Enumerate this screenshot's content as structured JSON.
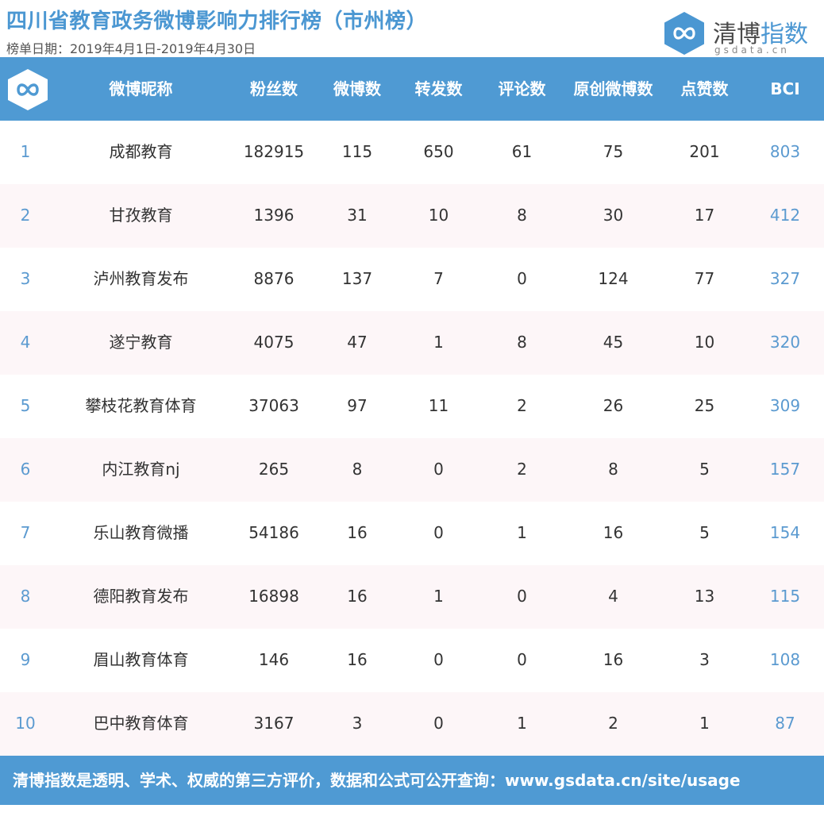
{
  "title": "四川省教育政务微博影响力排行榜（市州榜）",
  "date_range": "榜单日期：2019年4月1日-2019年4月30日",
  "brand": {
    "name_part1": "清博",
    "name_part2": "指数",
    "domain": "gsdata.cn",
    "color": "#4b97d2"
  },
  "columns": [
    "微博昵称",
    "粉丝数",
    "微博数",
    "转发数",
    "评论数",
    "原创微博数",
    "点赞数",
    "BCI"
  ],
  "rows": [
    {
      "rank": "1",
      "name": "成都教育",
      "fans": "182915",
      "posts": "115",
      "reposts": "650",
      "comments": "61",
      "original": "75",
      "likes": "201",
      "bci": "803"
    },
    {
      "rank": "2",
      "name": "甘孜教育",
      "fans": "1396",
      "posts": "31",
      "reposts": "10",
      "comments": "8",
      "original": "30",
      "likes": "17",
      "bci": "412"
    },
    {
      "rank": "3",
      "name": "泸州教育发布",
      "fans": "8876",
      "posts": "137",
      "reposts": "7",
      "comments": "0",
      "original": "124",
      "likes": "77",
      "bci": "327"
    },
    {
      "rank": "4",
      "name": "遂宁教育",
      "fans": "4075",
      "posts": "47",
      "reposts": "1",
      "comments": "8",
      "original": "45",
      "likes": "10",
      "bci": "320"
    },
    {
      "rank": "5",
      "name": "攀枝花教育体育",
      "fans": "37063",
      "posts": "97",
      "reposts": "11",
      "comments": "2",
      "original": "26",
      "likes": "25",
      "bci": "309"
    },
    {
      "rank": "6",
      "name": "内江教育nj",
      "fans": "265",
      "posts": "8",
      "reposts": "0",
      "comments": "2",
      "original": "8",
      "likes": "5",
      "bci": "157"
    },
    {
      "rank": "7",
      "name": "乐山教育微播",
      "fans": "54186",
      "posts": "16",
      "reposts": "0",
      "comments": "1",
      "original": "16",
      "likes": "5",
      "bci": "154"
    },
    {
      "rank": "8",
      "name": "德阳教育发布",
      "fans": "16898",
      "posts": "16",
      "reposts": "1",
      "comments": "0",
      "original": "4",
      "likes": "13",
      "bci": "115"
    },
    {
      "rank": "9",
      "name": "眉山教育体育",
      "fans": "146",
      "posts": "16",
      "reposts": "0",
      "comments": "0",
      "original": "16",
      "likes": "3",
      "bci": "108"
    },
    {
      "rank": "10",
      "name": "巴中教育体育",
      "fans": "3167",
      "posts": "3",
      "reposts": "0",
      "comments": "1",
      "original": "2",
      "likes": "1",
      "bci": "87"
    }
  ],
  "footer": "清博指数是透明、学术、权威的第三方评价，数据和公式可公开查询：www.gsdata.cn/site/usage",
  "colors": {
    "header_bg": "#4f9ad3",
    "title": "#4b97d2",
    "alt_row": "#fdf6f8",
    "rank_bci": "#5b9ad0"
  }
}
